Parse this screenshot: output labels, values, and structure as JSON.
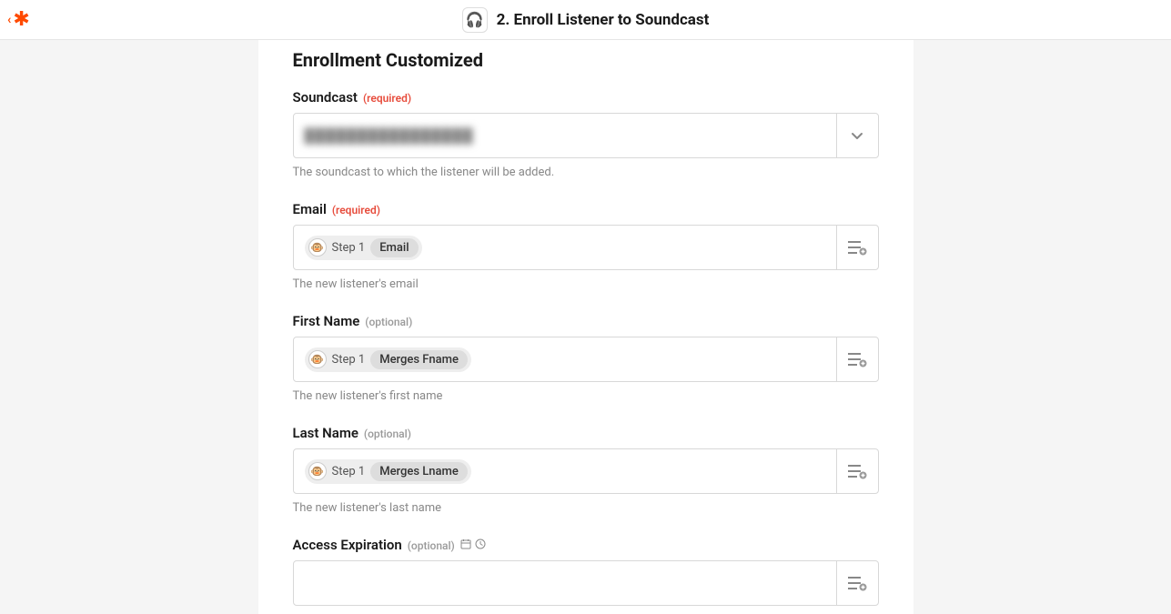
{
  "header": {
    "title": "2. Enroll Listener to Soundcast",
    "app_icon": "🎧"
  },
  "section": {
    "title": "Enrollment Customized"
  },
  "fields": {
    "soundcast": {
      "label": "Soundcast",
      "tag": "(required)",
      "value_masked": "████████████████",
      "help": "The soundcast to which the listener will be added."
    },
    "email": {
      "label": "Email",
      "tag": "(required)",
      "pill_step": "Step 1",
      "pill_value": "Email",
      "help": "The new listener's email"
    },
    "first_name": {
      "label": "First Name",
      "tag": "(optional)",
      "pill_step": "Step 1",
      "pill_value": "Merges Fname",
      "help": "The new listener's first name"
    },
    "last_name": {
      "label": "Last Name",
      "tag": "(optional)",
      "pill_step": "Step 1",
      "pill_value": "Merges Lname",
      "help": "The new listener's last name"
    },
    "access_expiration": {
      "label": "Access Expiration",
      "tag": "(optional)"
    }
  },
  "icons": {
    "mailchimp": "🐵"
  }
}
